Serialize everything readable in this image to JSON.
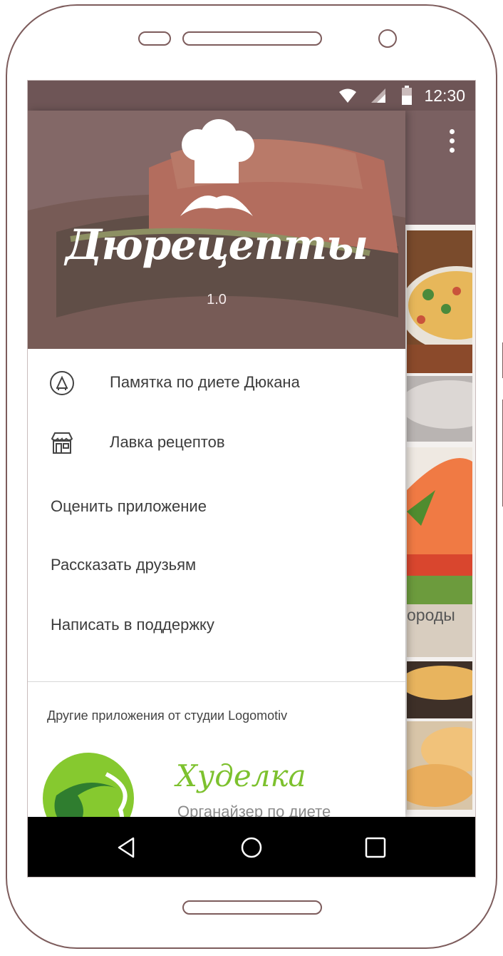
{
  "status_bar": {
    "time": "12:30"
  },
  "drawer": {
    "app_name": "Дюрецепты",
    "version": "1.0",
    "items": [
      {
        "label": "Памятка по диете Дюкана",
        "icon": "dukan-d-icon"
      },
      {
        "label": "Лавка рецептов",
        "icon": "store-icon"
      },
      {
        "label": "Оценить приложение"
      },
      {
        "label": "Рассказать друзьям"
      },
      {
        "label": "Написать в поддержку"
      }
    ],
    "other_apps_title": "Другие приложения от студии Logomotiv",
    "promo": {
      "name": "Худелка",
      "subtitle": "Органайзер по диете"
    }
  },
  "background": {
    "card_label_fragment": "ороды"
  },
  "colors": {
    "appbar": "#7a6061",
    "statusbar": "#6e5556",
    "promo_green": "#7dc12e"
  }
}
